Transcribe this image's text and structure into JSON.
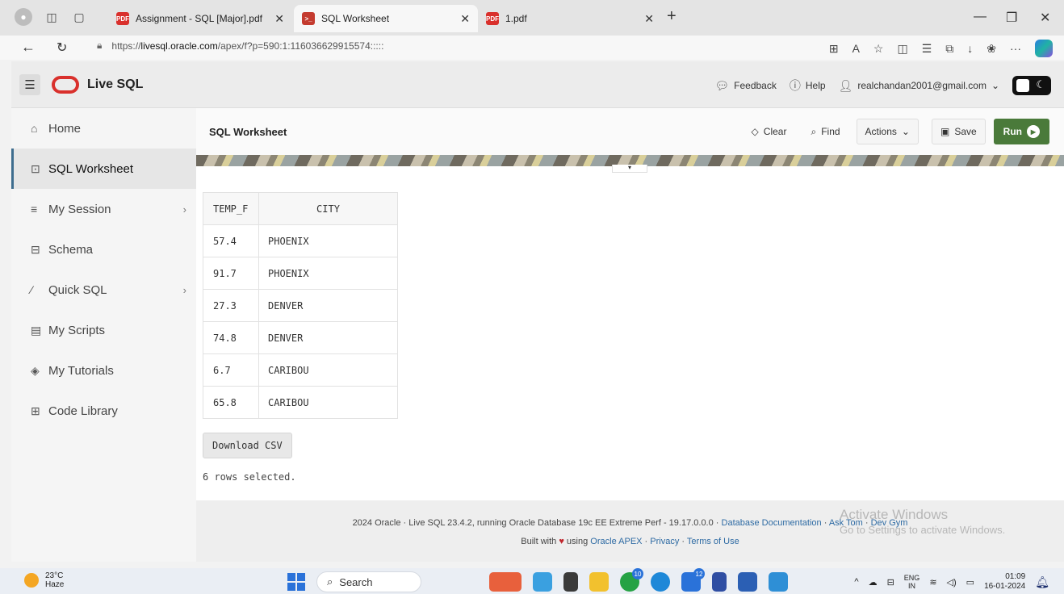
{
  "browser": {
    "tabs": [
      {
        "label": "Assignment - SQL [Major].pdf",
        "icon": "pdf-icon"
      },
      {
        "label": "SQL Worksheet",
        "icon": "sql-icon"
      },
      {
        "label": "1.pdf",
        "icon": "pdf-icon"
      }
    ],
    "url_prefix": "https://",
    "url_host": "livesql.oracle.com",
    "url_path": "/apex/f?p=590:1:116036629915574:::::"
  },
  "header": {
    "app_name": "Live SQL",
    "feedback": "Feedback",
    "help": "Help",
    "user": "realchandan2001@gmail.com"
  },
  "sidebar": {
    "items": [
      {
        "label": "Home",
        "icon": "home-icon"
      },
      {
        "label": "SQL Worksheet",
        "icon": "terminal-icon"
      },
      {
        "label": "My Session",
        "icon": "list-icon"
      },
      {
        "label": "Schema",
        "icon": "database-icon"
      },
      {
        "label": "Quick SQL",
        "icon": "wand-icon"
      },
      {
        "label": "My Scripts",
        "icon": "script-icon"
      },
      {
        "label": "My Tutorials",
        "icon": "graduation-icon"
      },
      {
        "label": "Code Library",
        "icon": "library-icon"
      }
    ]
  },
  "worksheet": {
    "title": "SQL Worksheet",
    "clear": "Clear",
    "find": "Find",
    "actions": "Actions",
    "save": "Save",
    "run": "Run"
  },
  "results": {
    "columns": [
      "TEMP_F",
      "CITY"
    ],
    "rows": [
      [
        "57.4",
        "PHOENIX"
      ],
      [
        "91.7",
        "PHOENIX"
      ],
      [
        "27.3",
        "DENVER"
      ],
      [
        "74.8",
        "DENVER"
      ],
      [
        "6.7",
        "CARIBOU"
      ],
      [
        "65.8",
        "CARIBOU"
      ]
    ],
    "download": "Download CSV",
    "rows_selected": "6 rows selected."
  },
  "footer": {
    "line1_text": "2024 Oracle · Live SQL 23.4.2, running Oracle Database 19c EE Extreme Perf - 19.17.0.0.0 · ",
    "doc_link": "Database Documentation",
    "sep1": " · ",
    "ask_tom": "Ask Tom",
    "sep2": " · ",
    "dev_gym": "Dev Gym",
    "built_with": "Built with ",
    "using": " using ",
    "apex": "Oracle APEX",
    "sep3": " · ",
    "privacy": "Privacy",
    "sep4": " · ",
    "terms": "Terms of Use"
  },
  "watermark": {
    "line1": "Activate Windows",
    "line2": "Go to Settings to activate Windows."
  },
  "taskbar": {
    "temp": "23°C",
    "weather": "Haze",
    "search": "Search",
    "badge_whatsapp": "10",
    "badge_mail": "12",
    "lang1": "ENG",
    "lang2": "IN",
    "time": "01:09",
    "date": "16-01-2024"
  },
  "colors": {
    "run_button": "#4a7a3a",
    "oracle_red": "#d9302c",
    "link": "#2d6aa3"
  }
}
